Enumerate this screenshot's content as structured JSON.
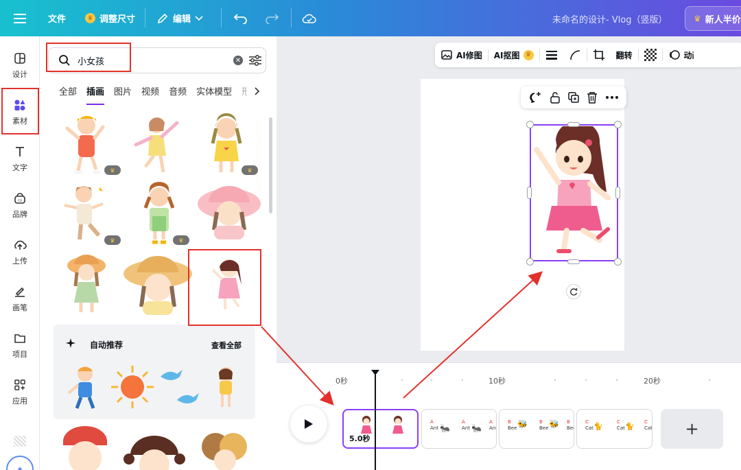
{
  "topbar": {
    "file": "文件",
    "resize": "调整尺寸",
    "edit": "编辑",
    "title": "未命名的设计- Vlog（竖版）",
    "trial": "新人半价"
  },
  "rail": {
    "items": [
      {
        "label": "设计",
        "icon": "layout-icon"
      },
      {
        "label": "素材",
        "icon": "elements-icon"
      },
      {
        "label": "文字",
        "icon": "text-icon"
      },
      {
        "label": "品牌",
        "icon": "brand-icon"
      },
      {
        "label": "上传",
        "icon": "upload-icon"
      },
      {
        "label": "画笔",
        "icon": "draw-icon"
      },
      {
        "label": "项目",
        "icon": "folder-icon"
      },
      {
        "label": "应用",
        "icon": "apps-icon"
      }
    ]
  },
  "panel": {
    "search_value": "小女孩",
    "tabs": [
      "全部",
      "插画",
      "图片",
      "视频",
      "音频",
      "实体模型",
      "形"
    ],
    "auto_title": "自动推荐",
    "view_all": "查看全部"
  },
  "toolbar": {
    "ai_retouch": "AI修图",
    "ai_cutout": "AI抠图",
    "flip": "翻转",
    "animate": "动画"
  },
  "timeline": {
    "ticks": [
      "0秒",
      "10秒",
      "20秒"
    ],
    "clip1_duration": "5.0秒",
    "add": "+",
    "clip_letters": {
      "ant": [
        "A",
        "Ant"
      ],
      "bee": [
        "B",
        "Bee"
      ],
      "cat": [
        "C",
        "Cat"
      ]
    }
  },
  "colors": {
    "accent": "#8b3dff",
    "highlight": "#e2312b",
    "crown": "#f7c744"
  }
}
